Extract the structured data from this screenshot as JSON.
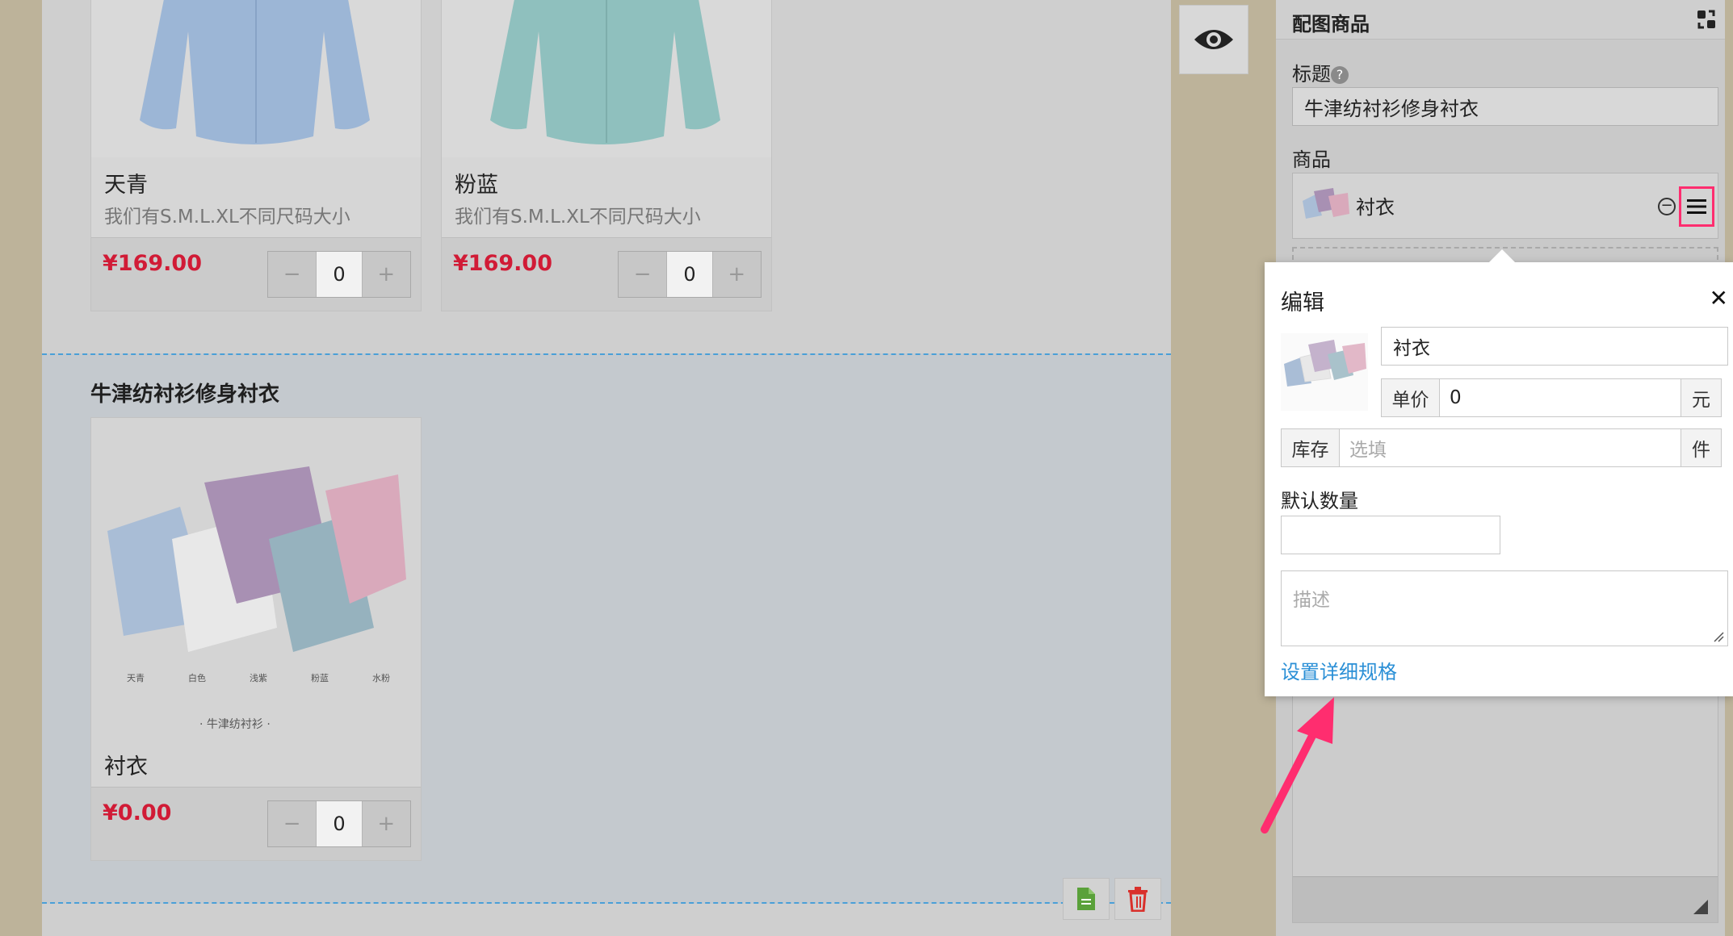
{
  "products_top": [
    {
      "name": "天青",
      "desc": "我们有S.M.L.XL不同尺码大小",
      "price": "¥169.00",
      "qty": "0",
      "minus": "−",
      "plus": "+"
    },
    {
      "name": "粉蓝",
      "desc": "我们有S.M.L.XL不同尺码大小",
      "price": "¥169.00",
      "qty": "0",
      "minus": "−",
      "plus": "+"
    }
  ],
  "section": {
    "title": "牛津纺衬衫修身衬衣",
    "product": {
      "name": "衬衣",
      "price": "¥0.00",
      "qty": "0",
      "minus": "−",
      "plus": "+"
    },
    "image_labels": [
      "天青",
      "白色",
      "浅紫",
      "粉蓝",
      "水粉"
    ],
    "image_caption": "· 牛津纺衬衫 ·"
  },
  "panel": {
    "header": "配图商品",
    "title_label": "标题",
    "title_value": "牛津纺衬衫修身衬衣",
    "goods_label": "商品",
    "goods_item": "衬衣"
  },
  "popup": {
    "title": "编辑",
    "close": "✕",
    "name_value": "衬衣",
    "price_label": "单价",
    "price_value": "0",
    "price_unit": "元",
    "stock_label": "库存",
    "stock_placeholder": "选填",
    "stock_unit": "件",
    "default_qty_label": "默认数量",
    "default_qty_value": "",
    "desc_placeholder": "描述",
    "spec_link": "设置详细规格"
  },
  "colors": {
    "price_red": "#d11b36",
    "link_blue": "#2a8fd6",
    "highlight_pink": "#ff2d6f",
    "dash_blue": "#4a9fd8"
  }
}
